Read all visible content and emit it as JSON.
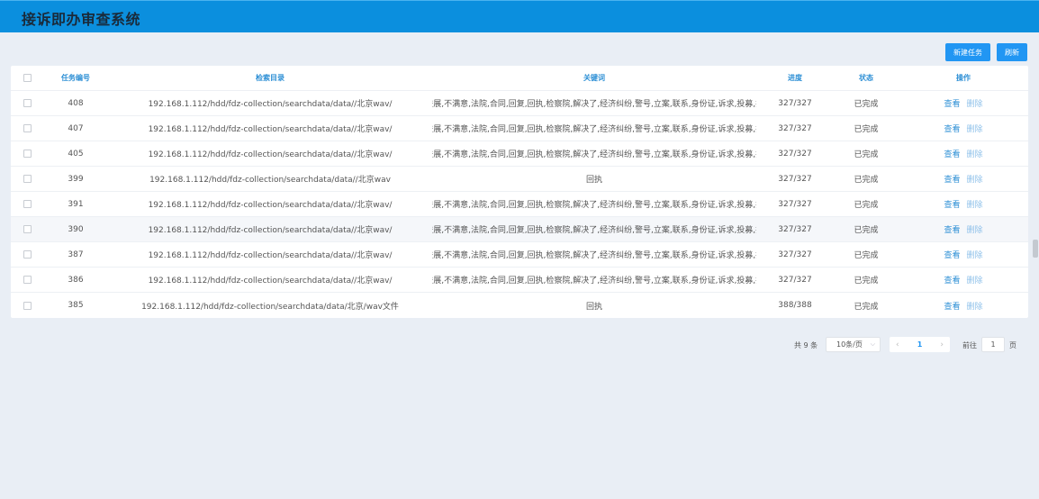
{
  "header": {
    "title": "接诉即办审查系统"
  },
  "toolbar": {
    "new_task_label": "新建任务",
    "refresh_label": "刷新"
  },
  "table": {
    "columns": {
      "id": "任务编号",
      "path": "检索目录",
      "keywords": "关键词",
      "progress": "进度",
      "status": "状态",
      "actions": "操作"
    },
    "rows": [
      {
        "id": "408",
        "path": "192.168.1.112/hdd/fdz-collection/searchdata/data//北京wav/",
        "keywords": "案情进展,不满意,法院,合同,回复,回执,检察院,解决了,经济纠纷,警号,立案,联系,身份证,诉求,投募,投诉...",
        "progress": "327/327",
        "status": "已完成",
        "view": "查看",
        "delete": "删除"
      },
      {
        "id": "407",
        "path": "192.168.1.112/hdd/fdz-collection/searchdata/data//北京wav/",
        "keywords": "案情进展,不满意,法院,合同,回复,回执,检察院,解决了,经济纠纷,警号,立案,联系,身份证,诉求,投募,投诉...",
        "progress": "327/327",
        "status": "已完成",
        "view": "查看",
        "delete": "删除"
      },
      {
        "id": "405",
        "path": "192.168.1.112/hdd/fdz-collection/searchdata/data//北京wav/",
        "keywords": "案情进展,不满意,法院,合同,回复,回执,检察院,解决了,经济纠纷,警号,立案,联系,身份证,诉求,投募,投诉...",
        "progress": "327/327",
        "status": "已完成",
        "view": "查看",
        "delete": "删除"
      },
      {
        "id": "399",
        "path": "192.168.1.112/hdd/fdz-collection/searchdata/data//北京wav",
        "keywords": "回执",
        "progress": "327/327",
        "status": "已完成",
        "view": "查看",
        "delete": "删除"
      },
      {
        "id": "391",
        "path": "192.168.1.112/hdd/fdz-collection/searchdata/data//北京wav/",
        "keywords": "案情进展,不满意,法院,合同,回复,回执,检察院,解决了,经济纠纷,警号,立案,联系,身份证,诉求,投募,投诉...",
        "progress": "327/327",
        "status": "已完成",
        "view": "查看",
        "delete": "删除"
      },
      {
        "id": "390",
        "path": "192.168.1.112/hdd/fdz-collection/searchdata/data//北京wav/",
        "keywords": "案情进展,不满意,法院,合同,回复,回执,检察院,解决了,经济纠纷,警号,立案,联系,身份证,诉求,投募,投诉...",
        "progress": "327/327",
        "status": "已完成",
        "view": "查看",
        "delete": "删除"
      },
      {
        "id": "387",
        "path": "192.168.1.112/hdd/fdz-collection/searchdata/data//北京wav/",
        "keywords": "案情进展,不满意,法院,合同,回复,回执,检察院,解决了,经济纠纷,警号,立案,联系,身份证,诉求,投募,投诉...",
        "progress": "327/327",
        "status": "已完成",
        "view": "查看",
        "delete": "删除"
      },
      {
        "id": "386",
        "path": "192.168.1.112/hdd/fdz-collection/searchdata/data//北京wav/",
        "keywords": "案情进展,不满意,法院,合同,回复,回执,检察院,解决了,经济纠纷,警号,立案,联系,身份证,诉求,投募,投诉...",
        "progress": "327/327",
        "status": "已完成",
        "view": "查看",
        "delete": "删除"
      },
      {
        "id": "385",
        "path": "192.168.1.112/hdd/fdz-collection/searchdata/data/北京/wav文件",
        "keywords": "回执",
        "progress": "388/388",
        "status": "已完成",
        "view": "查看",
        "delete": "删除"
      }
    ]
  },
  "pagination": {
    "total_label": "共 9 条",
    "page_size": "10条/页",
    "prev_icon": "chevron-left-icon",
    "next_icon": "chevron-right-icon",
    "current_page": "1",
    "goto_prefix": "前往",
    "goto_value": "1",
    "goto_suffix": "页"
  },
  "colors": {
    "header_bg": "#0b8fde",
    "accent": "#2196f3",
    "page_bg": "#e9eef5"
  }
}
